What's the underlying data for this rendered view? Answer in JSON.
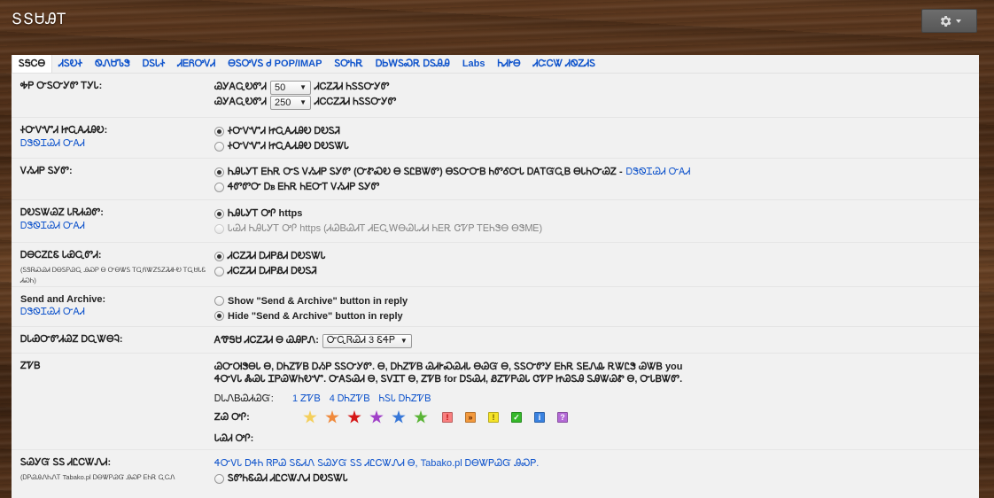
{
  "app": {
    "title": "ՏՏᏌᎯᎢ"
  },
  "tabs": [
    {
      "label": "ᏚᎦᏟᎾ",
      "active": true
    },
    {
      "label": "ᏗᏚᎧᏐ"
    },
    {
      "label": "ᏫᏁᏌᏖᏕ"
    },
    {
      "label": "ᎠᏚᏓᏐ"
    },
    {
      "label": "ᏗᎬᏲᎤᏙᏗ"
    },
    {
      "label": "ᎾᏚᎤᏙᏚ Ꮷ POP/IMAP"
    },
    {
      "label": "ᏚᎤᏂᎡ"
    },
    {
      "label": "ᎠᏏᎳᏚᏍᎡ ᎠᏚᎯᎯ"
    },
    {
      "label": "Labs"
    },
    {
      "label": "ᏂᏗᎨᎾ"
    },
    {
      "label": "ᏗᏨᏟᏔ ᏗᏫᏃᏗᏚ"
    }
  ],
  "rows": {
    "max_page": {
      "label": "ᎭᏢ ᏅᏚᏅᎩᏛ ᎢᎩᏓ:",
      "line1_prefix": "ᏊᎩᎪᏩᎧᏛᏗ",
      "line1_value": "50",
      "line1_suffix": "ᏗᏟᏃᏘᏗ ᏂᏚᏚᏅᎩᏛ",
      "line2_prefix": "ᏊᎩᎪᏩᎧᏛᏗ",
      "line2_value": "250",
      "line2_suffix": "ᏗᏟᏟᏃᏘᏗ ᏂᏚᏚᏅᎩᏛ"
    },
    "keyboard": {
      "label": "ᏐᏅᏙᏉᏗ ᏥᏩᎪᏗᎯᎧ:",
      "sub": "ᎠᏕᏫᏆᏊᏗ ᏅᎪᏗ",
      "opt1": "ᏐᏅᏙᏉᏗ ᏥᏩᎪᏗᎯᎧ ᎠᎧᏚᏘ",
      "opt2": "ᏐᏅᏙᏉᏗ ᏥᏩᎪᏗᎯᎧ ᎠᎧᏚᏔᏓ"
    },
    "view": {
      "label": "ᏙᏱᏗᏢ ᏚᎩᏛ:",
      "opt1": "ᏂᎯᏓᎩᎢ ᎬᏂᎡ ᏅᏚ ᏙᏱᏗᏢ ᏚᎩᏛ (ᏅᏑᏍᎧ Ꮎ ᏚᏝᏴᏔᏛ) ᎾᏚᏅᏅᏴ ᏂᏛᎴᏅᏓ ᎠᎪᎢᏳᏩᏴ ᎾᏓᏂᏅᏊᏃ -",
      "opt1_link": "ᎠᏕᏫᏆᏊᏗ ᏅᎪᏗ",
      "opt2": "ᏎᏛᏛᏅ Ꭰᏼ ᎬᏂᎡ ᏂᎬᏅᎢ ᏙᏱᏗᏢ ᏚᎩᏛ"
    },
    "connection": {
      "label": "ᎠᎧᏚᏔᏊᏃ ᏓᏒᏗᏊᏛ:",
      "sub": "ᎠᏕᏫᏆᏊᏗ ᏅᎪᏗ",
      "opt1": "ᏂᎯᏓᎩᎢ ᎤᎵ https",
      "opt2": "ᏓᏊᏗ ᏂᎯᏓᎩᎢ ᎤᎵ https (ᏗᏊᏴᏊᏗᎢ ᏗᎬᏩᎳᎾᏊᏓᏗᏗ ᏂᎬᎡ ᏣᏤᏢ ᎢᎬᏂᏕᎾ ᎾᏕᎷᎬ)"
    },
    "images": {
      "label": "ᎠᎾᏟᏃᏝᏋ ᏓᏯᏩᏛᏗ:",
      "note": "(ᏚᏕᏒᏍᏊᏗ ᎠᎾᏚᏢᏊᏩ ᎯᏍᏢ Ꮎ ᏅᎾᏔᏚ ᎢᏩᏲᏔᏃᏚᏃᏘᏗᎰᎧ ᎢᏩᏌᏓᏋ ᏗᏍᏂ)",
      "opt1": "ᏗᏟᏃᏘᏗ ᎠᏗᏢᏰᏗ ᎠᎧᏚᏔᏓ",
      "opt2": "ᏗᏟᏃᏘᏗ ᎠᏗᏢᏰᏗ ᎠᎧᏚᏘ"
    },
    "send_archive": {
      "label": "Send and Archive:",
      "sub": "ᎠᏕᏫᏆᏊᏗ ᏅᎪᏗ",
      "opt1": "Show \"Send & Archive\" button in reply",
      "opt2": "Hide \"Send & Archive\" button in reply"
    },
    "undo": {
      "label": "ᎠᏓᏯᏅᏛᏗᏊᏃ ᎠᏩᏔᎾᎸ:",
      "prefix": "ᎪᏡᎦᏌ ᏗᏟᏃᏘᏗ Ꮎ ᏊᎯᏢᏁ:",
      "value": "ᏅᏩᏒᏊᏗ 3 ᏋᏎᏢ"
    },
    "stars": {
      "label": "ᏃᏤᏴ",
      "desc": "ᏊᏅᎺᏕᎾᏓ Ꮎ, ᎠᏂᏃᏤᏴ ᎠᏱᏢ ᏚᏚᏅᎩᏛ. Ꮎ, ᎠᏂᏃᏤᏴ ᏊᏗᎨᏍᏊᏗᏓ ᎾᏊᏳ Ꮎ, ᏚᏚᏅᏛᎩ ᎬᏂᎡ ᏚᎬᏁᎲ ᎡᏔᏝᏕ ᏊᏔᏴ you ᏎᏅᏙᏓ ᏜᏊᏓ ᏆᏢᏊᏔᏂᎧᏉ. ᏅᎪᏚᏊᏗ Ꮎ, ᏚᏙᏆᎢ Ꮎ, ᏃᏤᏴ for ᎠᏚᏊᏗ, ᏰᏃᏤᏢᏊᏓ ᏣᏤᏢ ᏥᏊᏚᎯ ᏚᎯᏔᏊᏑ Ꮎ, ᏅᏓᏴᏔᏛ.",
      "presets_label": "ᎠᏓᏁᏴᏊᏗᏊᏳ:",
      "preset1": "1 ᏃᏤᏴ",
      "preset2": "4 ᎠᏂᏃᏤᏴ",
      "preset3": "ᏂᏚᏓ ᎠᏂᏃᏤᏴ",
      "in_use_label": "ᏃᏊ ᎤᎵ:",
      "not_in_use_label": "ᏓᏊᏗ ᎤᎵ:",
      "star_colors": [
        "#f4cf5c",
        "#f08a3c",
        "#d51717",
        "#a040c8",
        "#3878d8",
        "#5ab436"
      ],
      "square_icons": [
        {
          "glyph": "!",
          "bg": "#f97f7f",
          "fg": "#b30000"
        },
        {
          "glyph": "»",
          "bg": "#f39a3e",
          "fg": "#5a2000"
        },
        {
          "glyph": "!",
          "bg": "#f5e327",
          "fg": "#6b5600"
        },
        {
          "glyph": "✓",
          "bg": "#35b82a",
          "fg": "#ffffff"
        },
        {
          "glyph": "i",
          "bg": "#3a82e0",
          "fg": "#ffffff"
        },
        {
          "glyph": "?",
          "bg": "#b46ad6",
          "fg": "#ffffff"
        }
      ]
    },
    "tabako": {
      "label": "ᏚᏊᎩᏳ ᏚᏚ ᏗᏝᏟᏔᏁᏗ:",
      "note": "(ᎠᏢᏊᎯᏁᏂᏁᎢ Tabako.pl ᎠᎾᏔᏢᏊᏳ ᎯᏍᏢ ᎬᏂᎡ ᏩᏟᏁ",
      "opt0_link": "ᏎᏅᏙᏓ ᎠᏎᏂ ᏒᏢᏊ ᏚᏋᏗᏁ ᏚᏊᎩᏳ ᏚᏚ ᏗᏝᏟᏔᏁᏗ Ꮎ, Tabako.pl ᎠᎾᏔᏢᏊᏳ ᎯᏍᏢ.",
      "opt1": "ᏚᏛᏂᏋᏊᏗ ᏗᏝᏟᏔᏁᏗ ᎠᎧᏚᏔᏓ"
    }
  }
}
